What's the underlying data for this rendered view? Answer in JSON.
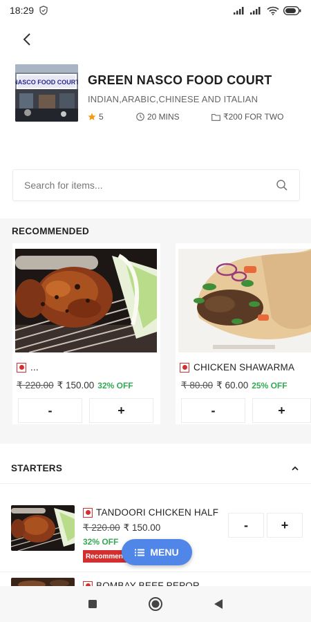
{
  "status_bar": {
    "time": "18:29"
  },
  "restaurant": {
    "name": "GREEN NASCO FOOD COURT",
    "cuisines": "INDIAN,ARABIC,CHINESE AND ITALIAN",
    "rating": "5",
    "delivery_time": "20 MINS",
    "cost_for_two": "₹200 FOR TWO",
    "image_sign_text": "NASCO FOOD COURT"
  },
  "search": {
    "placeholder": "Search for items..."
  },
  "recommended": {
    "title": "RECOMMENDED",
    "items": [
      {
        "name": "...",
        "old_price": "₹ 220.00",
        "new_price": "₹ 150.00",
        "discount": "32% OFF",
        "minus": "-",
        "plus": "+"
      },
      {
        "name": "CHICKEN SHAWARMA",
        "old_price": "₹ 80.00",
        "new_price": "₹ 60.00",
        "discount": "25% OFF",
        "minus": "-",
        "plus": "+"
      }
    ]
  },
  "starters": {
    "title": "STARTERS",
    "items": [
      {
        "name": "TANDOORI CHICKEN HALF",
        "old_price": "₹ 220.00",
        "new_price": "₹ 150.00",
        "discount": "32% OFF",
        "badge": "Recommended",
        "minus": "-",
        "plus": "+"
      },
      {
        "name": "BOMBAY BEEF PEPOR"
      }
    ]
  },
  "fab": {
    "label": "MENU"
  },
  "colors": {
    "accent": "#4f86e8",
    "discount": "#34a853",
    "non_veg": "#d32f2f"
  }
}
